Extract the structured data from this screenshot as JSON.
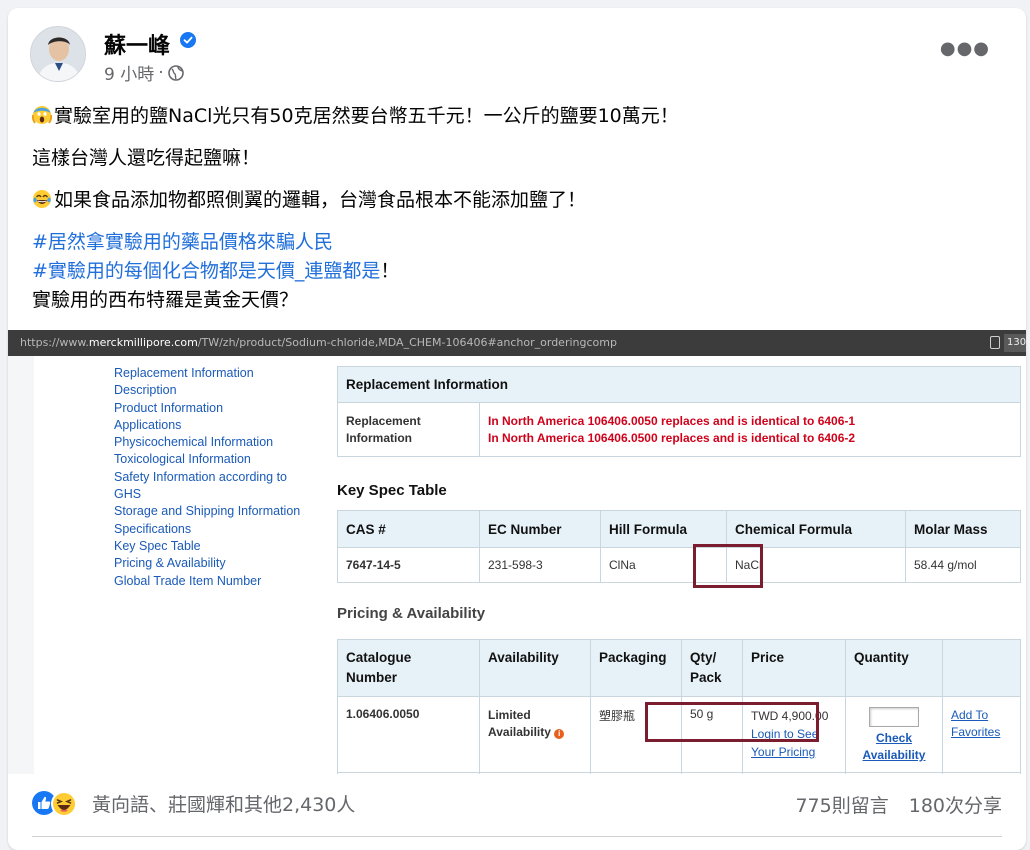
{
  "post": {
    "author": "蘇一峰",
    "time": "9 小時",
    "separator": "·",
    "paragraphs": [
      "實驗室用的鹽NaCl光只有50克居然要台幣五千元！一公斤的鹽要10萬元！",
      "這樣台灣人還吃得起鹽嘛！",
      "如果食品添加物都照側翼的邏輯，台灣食品根本不能添加鹽了！"
    ],
    "hashtag1": "#居然拿實驗用的藥品價格來騙人民",
    "hashtag2": "#實驗用的每個化合物都是天價_連鹽都是",
    "hashtag2_suffix": "！",
    "last_line": "實驗用的西布特羅是黃金天價？"
  },
  "screenshot": {
    "url_prefix": "https://www.",
    "url_domain": "merckmillipore.com",
    "url_rest": "/TW/zh/product/Sodium-chloride,MDA_CHEM-106406#anchor_orderingcomp",
    "url_right_num": "130",
    "sidebar": [
      "Replacement Information",
      "Description",
      "Product Information",
      "Applications",
      "Physicochemical Information",
      "Toxicological Information",
      "Safety Information according to",
      "GHS",
      "Storage and Shipping Information",
      "Specifications",
      "Key Spec Table",
      "Pricing & Availability",
      "Global Trade Item Number"
    ],
    "replacement": {
      "header": "Replacement Information",
      "label_line1": "Replacement",
      "label_line2": "Information",
      "line1": "In North America 106406.0050 replaces and is identical to 6406-1",
      "line2": "In North America 106406.0500 replaces and is identical to 6406-2"
    },
    "key_spec": {
      "title": "Key Spec Table",
      "headers": [
        "CAS #",
        "EC Number",
        "Hill Formula",
        "Chemical Formula",
        "Molar Mass"
      ],
      "row": [
        "7647-14-5",
        "231-598-3",
        "ClNa",
        "NaCl",
        "58.44 g/mol"
      ]
    },
    "pricing": {
      "title": "Pricing & Availability",
      "headers": {
        "catalogue1": "Catalogue",
        "catalogue2": "Number",
        "availability": "Availability",
        "packaging": "Packaging",
        "qty1": "Qty/",
        "qty2": "Pack",
        "price": "Price",
        "quantity": "Quantity"
      },
      "row": {
        "catalogue": "1.06406.0050",
        "availability1": "Limited",
        "availability2": "Availability",
        "info_icon": "i",
        "packaging": "塑膠瓶",
        "qty": "50 g",
        "price": "TWD 4,900.00",
        "login1": "Login to See",
        "login2": "Your Pricing",
        "check1": "Check",
        "check2": "Availability",
        "fav1": "Add To",
        "fav2": "Favorites"
      }
    }
  },
  "footer": {
    "reactions": "黃向語、莊國輝和其他2,430人",
    "comments": "775則留言",
    "shares": "180次分享"
  },
  "colors": {
    "hashtag": "#216fdb",
    "highlight_box": "#7a1d2e",
    "table_header_bg": "#e7f2f8",
    "link": "#1a5ab8",
    "warning_red": "#d0021b"
  }
}
